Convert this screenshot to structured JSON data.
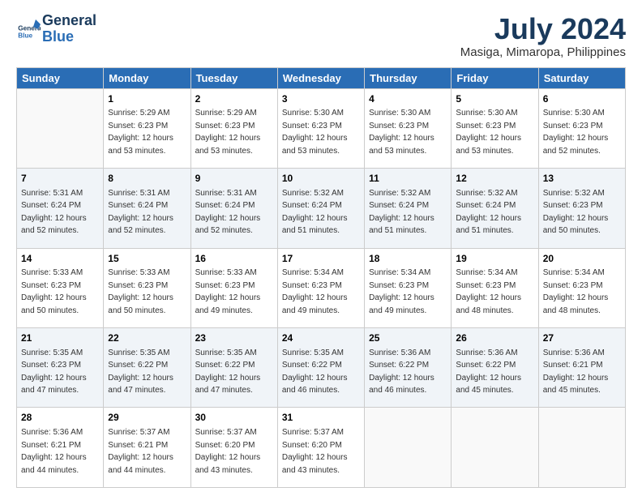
{
  "header": {
    "logo_line1": "General",
    "logo_line2": "Blue",
    "title": "July 2024",
    "subtitle": "Masiga, Mimaropa, Philippines"
  },
  "columns": [
    "Sunday",
    "Monday",
    "Tuesday",
    "Wednesday",
    "Thursday",
    "Friday",
    "Saturday"
  ],
  "weeks": [
    [
      {
        "day": "",
        "sunrise": "",
        "sunset": "",
        "daylight": "",
        "empty": true
      },
      {
        "day": "1",
        "sunrise": "Sunrise: 5:29 AM",
        "sunset": "Sunset: 6:23 PM",
        "daylight": "Daylight: 12 hours and 53 minutes."
      },
      {
        "day": "2",
        "sunrise": "Sunrise: 5:29 AM",
        "sunset": "Sunset: 6:23 PM",
        "daylight": "Daylight: 12 hours and 53 minutes."
      },
      {
        "day": "3",
        "sunrise": "Sunrise: 5:30 AM",
        "sunset": "Sunset: 6:23 PM",
        "daylight": "Daylight: 12 hours and 53 minutes."
      },
      {
        "day": "4",
        "sunrise": "Sunrise: 5:30 AM",
        "sunset": "Sunset: 6:23 PM",
        "daylight": "Daylight: 12 hours and 53 minutes."
      },
      {
        "day": "5",
        "sunrise": "Sunrise: 5:30 AM",
        "sunset": "Sunset: 6:23 PM",
        "daylight": "Daylight: 12 hours and 53 minutes."
      },
      {
        "day": "6",
        "sunrise": "Sunrise: 5:30 AM",
        "sunset": "Sunset: 6:23 PM",
        "daylight": "Daylight: 12 hours and 52 minutes."
      }
    ],
    [
      {
        "day": "7",
        "sunrise": "Sunrise: 5:31 AM",
        "sunset": "Sunset: 6:24 PM",
        "daylight": "Daylight: 12 hours and 52 minutes."
      },
      {
        "day": "8",
        "sunrise": "Sunrise: 5:31 AM",
        "sunset": "Sunset: 6:24 PM",
        "daylight": "Daylight: 12 hours and 52 minutes."
      },
      {
        "day": "9",
        "sunrise": "Sunrise: 5:31 AM",
        "sunset": "Sunset: 6:24 PM",
        "daylight": "Daylight: 12 hours and 52 minutes."
      },
      {
        "day": "10",
        "sunrise": "Sunrise: 5:32 AM",
        "sunset": "Sunset: 6:24 PM",
        "daylight": "Daylight: 12 hours and 51 minutes."
      },
      {
        "day": "11",
        "sunrise": "Sunrise: 5:32 AM",
        "sunset": "Sunset: 6:24 PM",
        "daylight": "Daylight: 12 hours and 51 minutes."
      },
      {
        "day": "12",
        "sunrise": "Sunrise: 5:32 AM",
        "sunset": "Sunset: 6:24 PM",
        "daylight": "Daylight: 12 hours and 51 minutes."
      },
      {
        "day": "13",
        "sunrise": "Sunrise: 5:32 AM",
        "sunset": "Sunset: 6:23 PM",
        "daylight": "Daylight: 12 hours and 50 minutes."
      }
    ],
    [
      {
        "day": "14",
        "sunrise": "Sunrise: 5:33 AM",
        "sunset": "Sunset: 6:23 PM",
        "daylight": "Daylight: 12 hours and 50 minutes."
      },
      {
        "day": "15",
        "sunrise": "Sunrise: 5:33 AM",
        "sunset": "Sunset: 6:23 PM",
        "daylight": "Daylight: 12 hours and 50 minutes."
      },
      {
        "day": "16",
        "sunrise": "Sunrise: 5:33 AM",
        "sunset": "Sunset: 6:23 PM",
        "daylight": "Daylight: 12 hours and 49 minutes."
      },
      {
        "day": "17",
        "sunrise": "Sunrise: 5:34 AM",
        "sunset": "Sunset: 6:23 PM",
        "daylight": "Daylight: 12 hours and 49 minutes."
      },
      {
        "day": "18",
        "sunrise": "Sunrise: 5:34 AM",
        "sunset": "Sunset: 6:23 PM",
        "daylight": "Daylight: 12 hours and 49 minutes."
      },
      {
        "day": "19",
        "sunrise": "Sunrise: 5:34 AM",
        "sunset": "Sunset: 6:23 PM",
        "daylight": "Daylight: 12 hours and 48 minutes."
      },
      {
        "day": "20",
        "sunrise": "Sunrise: 5:34 AM",
        "sunset": "Sunset: 6:23 PM",
        "daylight": "Daylight: 12 hours and 48 minutes."
      }
    ],
    [
      {
        "day": "21",
        "sunrise": "Sunrise: 5:35 AM",
        "sunset": "Sunset: 6:23 PM",
        "daylight": "Daylight: 12 hours and 47 minutes."
      },
      {
        "day": "22",
        "sunrise": "Sunrise: 5:35 AM",
        "sunset": "Sunset: 6:22 PM",
        "daylight": "Daylight: 12 hours and 47 minutes."
      },
      {
        "day": "23",
        "sunrise": "Sunrise: 5:35 AM",
        "sunset": "Sunset: 6:22 PM",
        "daylight": "Daylight: 12 hours and 47 minutes."
      },
      {
        "day": "24",
        "sunrise": "Sunrise: 5:35 AM",
        "sunset": "Sunset: 6:22 PM",
        "daylight": "Daylight: 12 hours and 46 minutes."
      },
      {
        "day": "25",
        "sunrise": "Sunrise: 5:36 AM",
        "sunset": "Sunset: 6:22 PM",
        "daylight": "Daylight: 12 hours and 46 minutes."
      },
      {
        "day": "26",
        "sunrise": "Sunrise: 5:36 AM",
        "sunset": "Sunset: 6:22 PM",
        "daylight": "Daylight: 12 hours and 45 minutes."
      },
      {
        "day": "27",
        "sunrise": "Sunrise: 5:36 AM",
        "sunset": "Sunset: 6:21 PM",
        "daylight": "Daylight: 12 hours and 45 minutes."
      }
    ],
    [
      {
        "day": "28",
        "sunrise": "Sunrise: 5:36 AM",
        "sunset": "Sunset: 6:21 PM",
        "daylight": "Daylight: 12 hours and 44 minutes."
      },
      {
        "day": "29",
        "sunrise": "Sunrise: 5:37 AM",
        "sunset": "Sunset: 6:21 PM",
        "daylight": "Daylight: 12 hours and 44 minutes."
      },
      {
        "day": "30",
        "sunrise": "Sunrise: 5:37 AM",
        "sunset": "Sunset: 6:20 PM",
        "daylight": "Daylight: 12 hours and 43 minutes."
      },
      {
        "day": "31",
        "sunrise": "Sunrise: 5:37 AM",
        "sunset": "Sunset: 6:20 PM",
        "daylight": "Daylight: 12 hours and 43 minutes."
      },
      {
        "day": "",
        "sunrise": "",
        "sunset": "",
        "daylight": "",
        "empty": true
      },
      {
        "day": "",
        "sunrise": "",
        "sunset": "",
        "daylight": "",
        "empty": true
      },
      {
        "day": "",
        "sunrise": "",
        "sunset": "",
        "daylight": "",
        "empty": true
      }
    ]
  ]
}
